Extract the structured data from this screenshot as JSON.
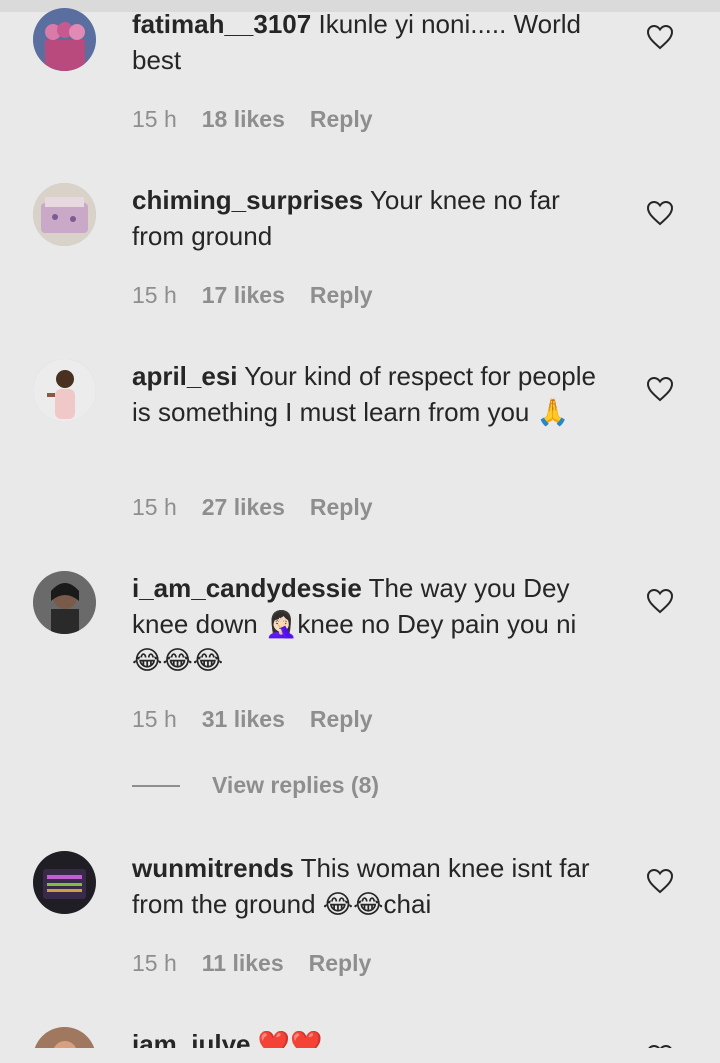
{
  "comments": [
    {
      "username": "fatimah__3107",
      "text": "Ikunle yi noni..... World best",
      "time": "15 h",
      "likes": "18 likes",
      "reply": "Reply"
    },
    {
      "username": "chiming_surprises",
      "text": "Your knee no far from ground",
      "time": "15 h",
      "likes": "17 likes",
      "reply": "Reply"
    },
    {
      "username": "april_esi",
      "text": "Your kind of respect for people is something I must learn from you 🙏",
      "time": "15 h",
      "likes": "27 likes",
      "reply": "Reply"
    },
    {
      "username": "i_am_candydessie",
      "text": "The way you Dey knee down 🤦🏻‍♀️knee no Dey pain you ni 😂😂😂",
      "time": "15 h",
      "likes": "31 likes",
      "reply": "Reply",
      "view_replies": "View replies (8)"
    },
    {
      "username": "wunmitrends",
      "text": "This woman knee isnt far from the ground 😂😂chai",
      "time": "15 h",
      "likes": "11 likes",
      "reply": "Reply"
    },
    {
      "username": "iam_julye",
      "text": "❤️❤️"
    }
  ],
  "icons": {
    "like": "heart-outline-icon"
  },
  "colors": {
    "background": "#e9e9e9",
    "text": "#262626",
    "secondary": "#8e8e8e"
  }
}
